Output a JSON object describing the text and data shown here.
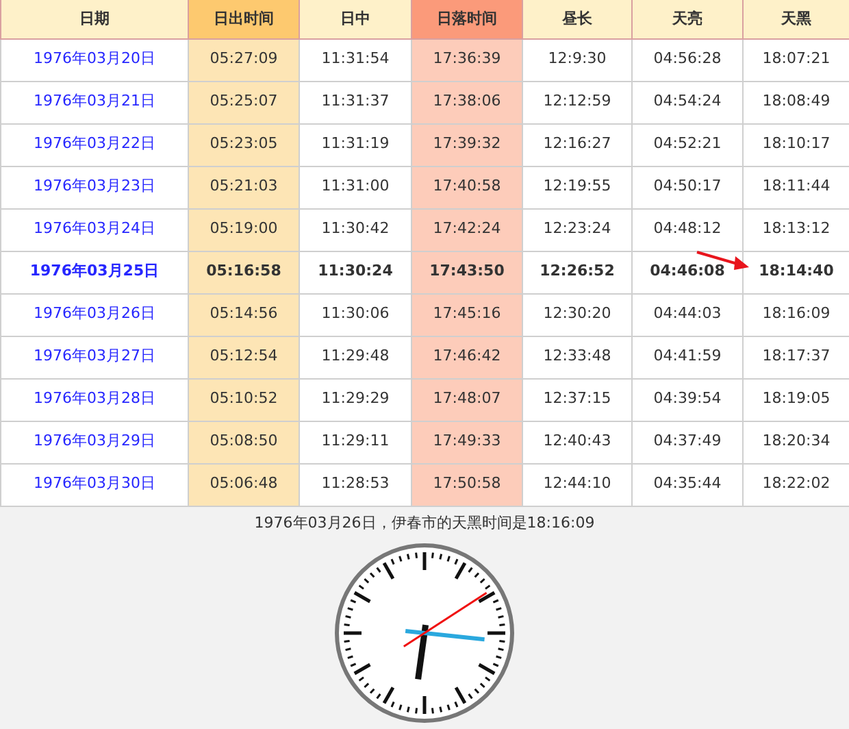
{
  "table": {
    "columns": [
      {
        "label": "日期",
        "kind": "date"
      },
      {
        "label": "日出时间",
        "kind": "sunrise"
      },
      {
        "label": "日中",
        "kind": "plain"
      },
      {
        "label": "日落时间",
        "kind": "sunset"
      },
      {
        "label": "昼长",
        "kind": "plain"
      },
      {
        "label": "天亮",
        "kind": "plain"
      },
      {
        "label": "天黑",
        "kind": "plain"
      }
    ],
    "rows": [
      {
        "cells": [
          "1976年03月20日",
          "05:27:09",
          "11:31:54",
          "17:36:39",
          "12:9:30",
          "04:56:28",
          "18:07:21"
        ],
        "highlighted": false,
        "pointed": false
      },
      {
        "cells": [
          "1976年03月21日",
          "05:25:07",
          "11:31:37",
          "17:38:06",
          "12:12:59",
          "04:54:24",
          "18:08:49"
        ],
        "highlighted": false,
        "pointed": false
      },
      {
        "cells": [
          "1976年03月22日",
          "05:23:05",
          "11:31:19",
          "17:39:32",
          "12:16:27",
          "04:52:21",
          "18:10:17"
        ],
        "highlighted": false,
        "pointed": false
      },
      {
        "cells": [
          "1976年03月23日",
          "05:21:03",
          "11:31:00",
          "17:40:58",
          "12:19:55",
          "04:50:17",
          "18:11:44"
        ],
        "highlighted": false,
        "pointed": false
      },
      {
        "cells": [
          "1976年03月24日",
          "05:19:00",
          "11:30:42",
          "17:42:24",
          "12:23:24",
          "04:48:12",
          "18:13:12"
        ],
        "highlighted": false,
        "pointed": false
      },
      {
        "cells": [
          "1976年03月25日",
          "05:16:58",
          "11:30:24",
          "17:43:50",
          "12:26:52",
          "04:46:08",
          "18:14:40"
        ],
        "highlighted": true,
        "pointed": true
      },
      {
        "cells": [
          "1976年03月26日",
          "05:14:56",
          "11:30:06",
          "17:45:16",
          "12:30:20",
          "04:44:03",
          "18:16:09"
        ],
        "highlighted": false,
        "pointed": false
      },
      {
        "cells": [
          "1976年03月27日",
          "05:12:54",
          "11:29:48",
          "17:46:42",
          "12:33:48",
          "04:41:59",
          "18:17:37"
        ],
        "highlighted": false,
        "pointed": false
      },
      {
        "cells": [
          "1976年03月28日",
          "05:10:52",
          "11:29:29",
          "17:48:07",
          "12:37:15",
          "04:39:54",
          "18:19:05"
        ],
        "highlighted": false,
        "pointed": false
      },
      {
        "cells": [
          "1976年03月29日",
          "05:08:50",
          "11:29:11",
          "17:49:33",
          "12:40:43",
          "04:37:49",
          "18:20:34"
        ],
        "highlighted": false,
        "pointed": false
      },
      {
        "cells": [
          "1976年03月30日",
          "05:06:48",
          "11:28:53",
          "17:50:58",
          "12:44:10",
          "04:35:44",
          "18:22:02"
        ],
        "highlighted": false,
        "pointed": false
      }
    ]
  },
  "caption": "1976年03月26日，伊春市的天黑时间是18:16:09"
}
